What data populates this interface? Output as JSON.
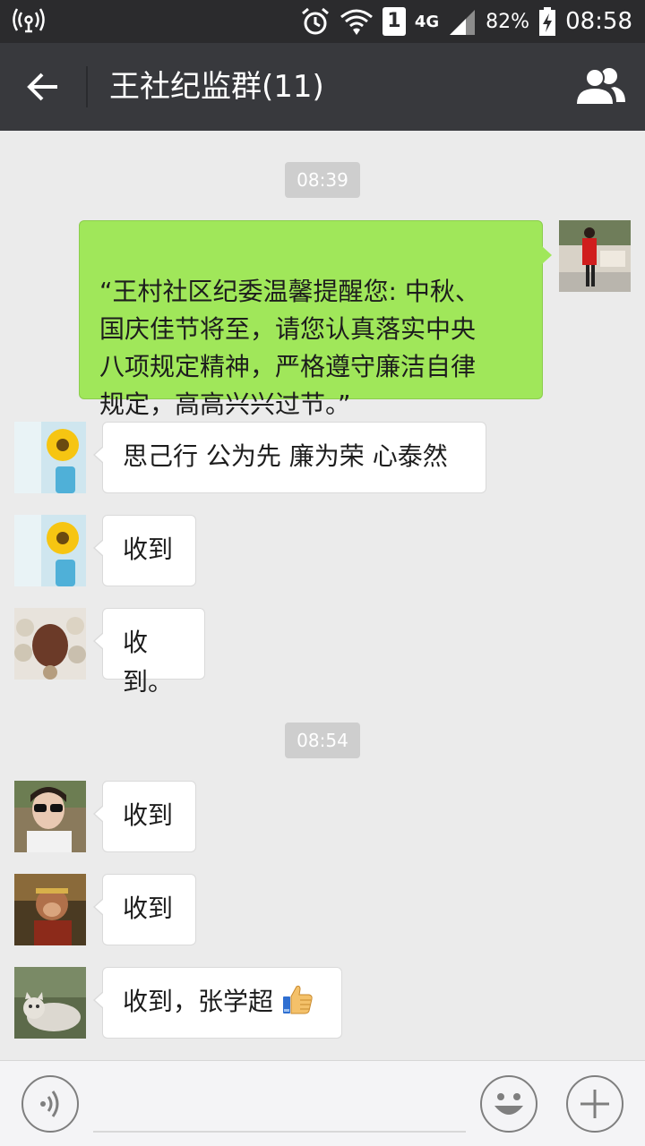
{
  "status_bar": {
    "sim_slot": "1",
    "network": "4G",
    "battery": "82%",
    "time": "08:58",
    "icons": [
      "wireless-broadcast-icon",
      "alarm-icon",
      "wifi-icon",
      "sim-1-icon",
      "signal-icon",
      "battery-charging-icon"
    ]
  },
  "header": {
    "title": "王社纪监群(11)"
  },
  "chat": {
    "time_stamps": [
      "08:39",
      "08:54"
    ],
    "messages": [
      {
        "direction": "out",
        "avatar": "woman-red-coat-avatar",
        "text": "“王村社区纪委温馨提醒您: 中秋、\n国庆佳节将至，请您认真落实中央\n八项规定精神，严格遵守廉洁自律\n规定，高高兴兴过节。”"
      },
      {
        "direction": "in",
        "avatar": "sunflower-avatar",
        "text": "思己行 公为先 廉为荣 心泰然"
      },
      {
        "direction": "in",
        "avatar": "sunflower-avatar",
        "text": "收到"
      },
      {
        "direction": "in",
        "avatar": "jade-beads-avatar",
        "text": "收到。"
      },
      {
        "direction": "in",
        "avatar": "sunglasses-woman-avatar",
        "text": "收到"
      },
      {
        "direction": "in",
        "avatar": "monkey-king-avatar",
        "text": "收到"
      },
      {
        "direction": "in",
        "avatar": "cat-avatar",
        "text": "收到，张学超",
        "emoji": "thumbs-up-icon"
      }
    ]
  },
  "colors": {
    "status_bar_bg": "#2b2b2d",
    "header_bg": "#38393d",
    "chat_bg": "#ebebeb",
    "outgoing_bubble": "#a0e75a",
    "incoming_bubble": "#ffffff",
    "time_badge": "#cecece"
  }
}
